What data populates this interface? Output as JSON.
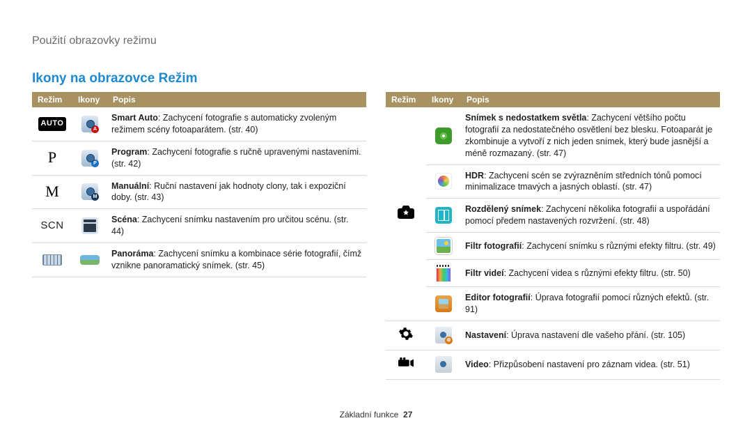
{
  "breadcrumb": "Použití obrazovky režimu",
  "heading": "Ikony na obrazovce Režim",
  "headers": {
    "mode": "Režim",
    "icons": "Ikony",
    "desc": "Popis"
  },
  "left": {
    "modes": {
      "auto": "AUTO",
      "p": "P",
      "m": "M",
      "scn": "SCN"
    },
    "rows": [
      {
        "b": "Smart Auto",
        "t": ": Zachycení fotografie s automaticky zvoleným režimem scény fotoaparátem. (str. 40)"
      },
      {
        "b": "Program",
        "t": ": Zachycení fotografie s ručně upravenými nastaveními. (str. 42)"
      },
      {
        "b": "Manuální",
        "t": ": Ruční nastavení jak hodnoty clony, tak i expoziční doby. (str. 43)"
      },
      {
        "b": "Scéna",
        "t": ": Zachycení snímku nastavením pro určitou scénu. (str. 44)"
      },
      {
        "b": "Panoráma",
        "t": ": Zachycení snímku a kombinace série fotografií, čímž vznikne panoramatický snímek. (str. 45)"
      }
    ]
  },
  "right": {
    "rows": [
      {
        "b": "Snímek s nedostatkem světla",
        "t": ": Zachycení většího počtu fotografií za nedostatečného osvětlení bez blesku. Fotoaparát je zkombinuje a vytvoří z nich jeden snímek, který bude jasnější a méně rozmazaný. (str. 47)"
      },
      {
        "b": "HDR",
        "t": ": Zachycení scén se zvýrazněním středních tónů pomocí minimalizace tmavých a jasných oblastí. (str. 47)"
      },
      {
        "b": "Rozdělený snímek",
        "t": ": Zachycení několika fotografií a uspořádání pomocí předem nastavených rozvržení. (str. 48)"
      },
      {
        "b": "Filtr fotografií",
        "t": ": Zachycení snímku s různými efekty filtru. (str. 49)"
      },
      {
        "b": "Filtr videí",
        "t": ": Zachycení videa s různými efekty filtru. (str. 50)"
      },
      {
        "b": "Editor fotografií",
        "t": ": Úprava fotografií pomocí různých efektů. (str. 91)"
      },
      {
        "b": "Nastavení",
        "t": ": Úprava nastavení dle vašeho přání. (str. 105)"
      },
      {
        "b": "Video",
        "t": ": Přizpůsobení nastavení pro záznam videa. (str. 51)"
      }
    ]
  },
  "footer": {
    "label": "Základní funkce",
    "page": "27"
  }
}
